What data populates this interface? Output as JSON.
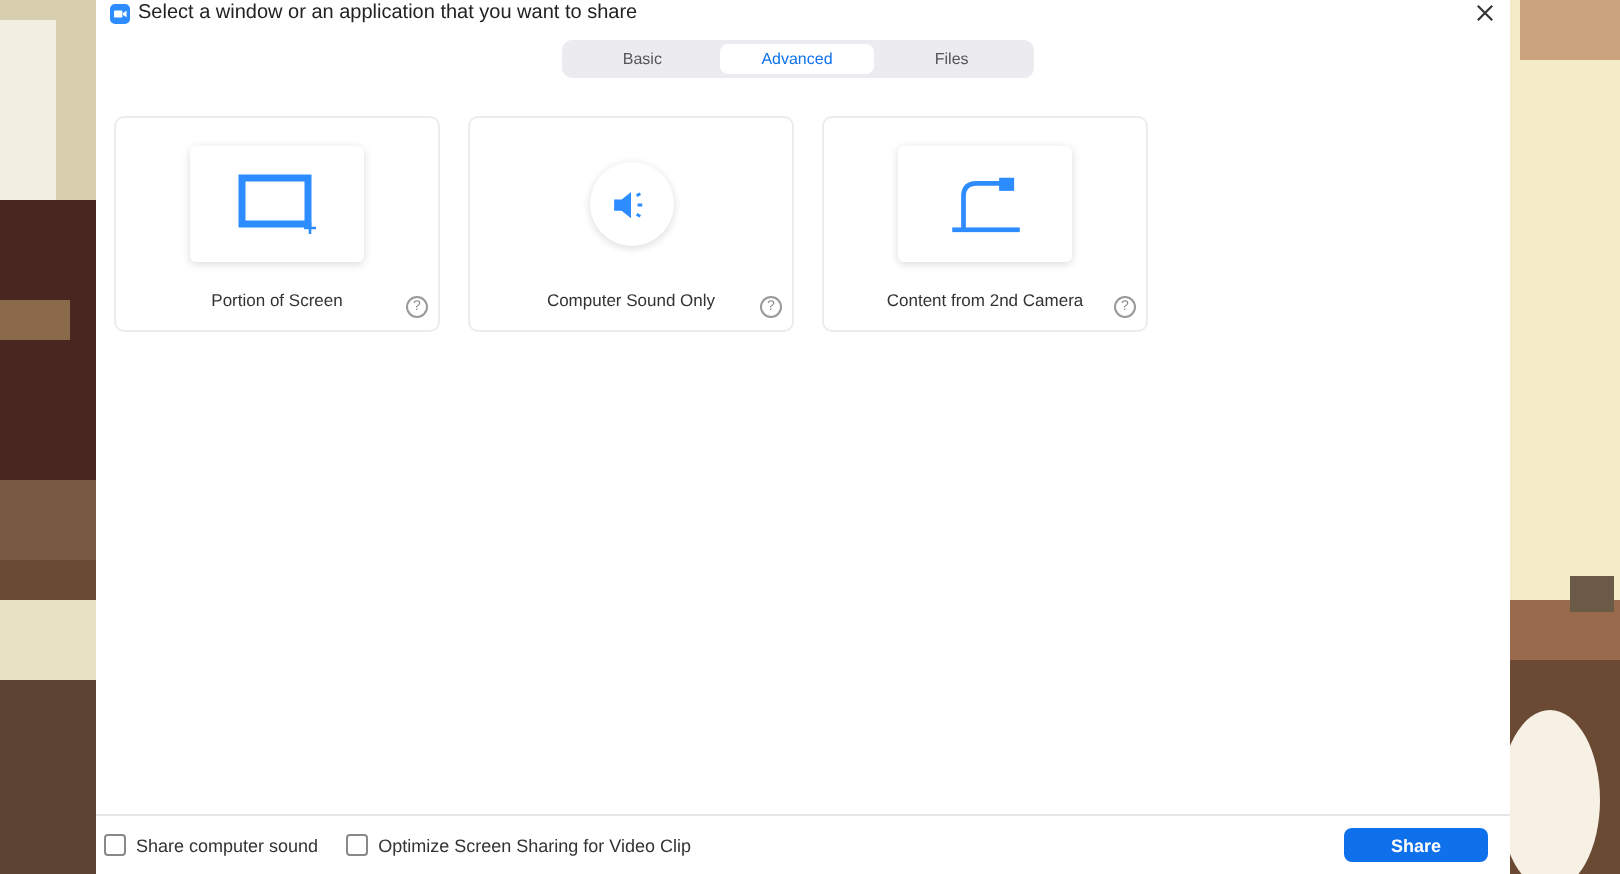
{
  "window": {
    "title": "Select a window or an application that you want to share"
  },
  "tabs": [
    {
      "label": "Basic",
      "selected": false
    },
    {
      "label": "Advanced",
      "selected": true
    },
    {
      "label": "Files",
      "selected": false
    }
  ],
  "options": [
    {
      "kind": "portion",
      "label": "Portion of Screen",
      "help": "?"
    },
    {
      "kind": "sound",
      "label": "Computer Sound Only",
      "help": "?"
    },
    {
      "kind": "camera",
      "label": "Content from 2nd Camera",
      "help": "?"
    }
  ],
  "checkboxes": [
    {
      "label": "Share computer sound",
      "checked": false
    },
    {
      "label": "Optimize Screen Sharing for Video Clip",
      "checked": false
    }
  ],
  "share_button": "Share"
}
